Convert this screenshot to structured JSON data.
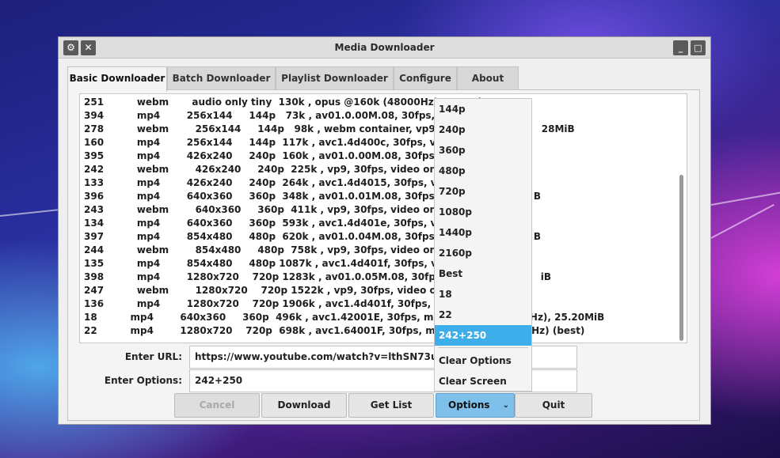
{
  "window": {
    "title": "Media Downloader"
  },
  "tabs": [
    {
      "label": "Basic Downloader"
    },
    {
      "label": "Batch Downloader"
    },
    {
      "label": "Playlist Downloader"
    },
    {
      "label": "Configure"
    },
    {
      "label": "About"
    }
  ],
  "formats": [
    "251          webm       audio only tiny  130k , opus @160k (48000Hz), 6.20MiB",
    "394          mp4        256x144     144p   73k , av01.0.00M.08, 30fps, vi",
    "278          webm        256x144     144p   98k , webm container, vp9, 30                          28MiB",
    "160          mp4        256x144     144p  117k , avc1.4d400c, 30fps, vide",
    "395          mp4        426x240     240p  160k , av01.0.00M.08, 30fps, vi",
    "242          webm        426x240     240p  225k , vp9, 30fps, video only,",
    "133          mp4        426x240     240p  264k , avc1.4d4015, 30fps, vide",
    "396          mp4        640x360     360p  348k , av01.0.01M.08, 30fps, vi                         B",
    "243          webm        640x360     360p  411k , vp9, 30fps, video only,",
    "134          mp4        640x360     360p  593k , avc1.4d401e, 30fps, vide",
    "397          mp4        854x480     480p  620k , av01.0.04M.08, 30fps, vi                         B",
    "244          webm        854x480     480p  758k , vp9, 30fps, video only,",
    "135          mp4        854x480     480p 1087k , avc1.4d401f, 30fps, vide",
    "398          mp4        1280x720    720p 1283k , av01.0.05M.08, 30fps,                             iB",
    "247          webm        1280x720    720p 1522k , vp9, 30fps, video only,",
    "136          mp4        1280x720    720p 1906k , avc1.4d401f, 30fps, vid",
    "18          mp4        640x360     360p  496k , avc1.42001E, 30fps, mp4                       0Hz), 25.20MiB",
    "22          mp4        1280x720    720p  698k , avc1.64001F, 30fps, mp4                       0Hz) (best)"
  ],
  "url": {
    "label": "Enter URL:",
    "value": "https://www.youtube.com/watch?v=lthSN73uZ"
  },
  "options": {
    "label": "Enter Options:",
    "value": "242+250"
  },
  "buttons": {
    "cancel": "Cancel",
    "download": "Download",
    "get_list": "Get List",
    "options": "Options",
    "quit": "Quit"
  },
  "dropdown": {
    "items": [
      "144p",
      "240p",
      "360p",
      "480p",
      "720p",
      "1080p",
      "1440p",
      "2160p",
      "Best",
      "18",
      "22",
      "242+250"
    ],
    "selected": "242+250",
    "actions": [
      "Clear Options",
      "Clear Screen"
    ]
  },
  "colors": {
    "selection": "#3daee9",
    "options_button": "#7fc0ea"
  }
}
